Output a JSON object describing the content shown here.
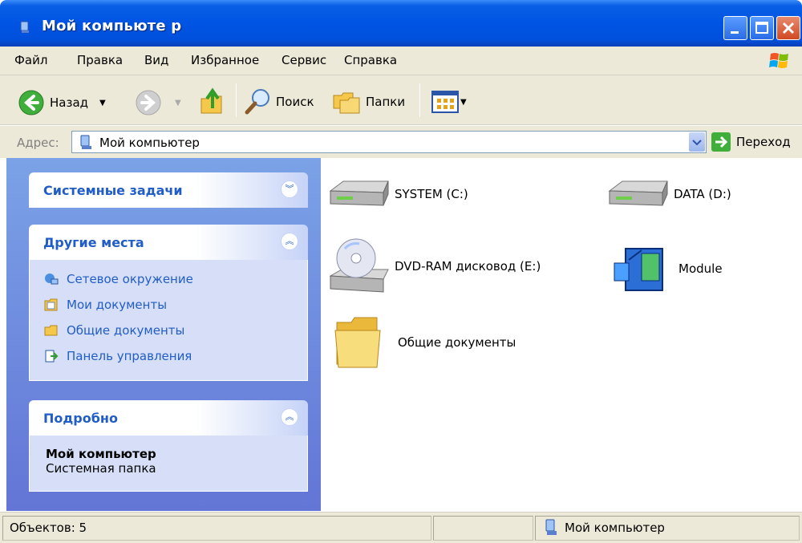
{
  "window": {
    "title": "Мой компьюте р"
  },
  "menu": [
    "Файл",
    "Правка",
    "Вид",
    "Избранное",
    "Сервис",
    "Справка"
  ],
  "toolbar": {
    "back_label": "Назад",
    "search_label": "Поиск",
    "folders_label": "Папки"
  },
  "address": {
    "label": "Адрес:",
    "value": "Мой компьютер",
    "go_label": "Переход"
  },
  "tasks": {
    "system": {
      "title": "Системные задачи"
    },
    "other": {
      "title": "Другие места",
      "links": [
        "Сетевое окружение",
        "Мои документы",
        "Общие документы",
        "Панель управления"
      ]
    },
    "details": {
      "title": "Подробно",
      "name": "Мой компьютер",
      "type": "Системная папка"
    }
  },
  "items": [
    {
      "label": "SYSTEM (C:)",
      "icon": "hard-drive-icon"
    },
    {
      "label": "DATA (D:)",
      "icon": "hard-drive-icon"
    },
    {
      "label": "DVD-RAM дисковод (E:)",
      "icon": "dvd-drive-icon"
    },
    {
      "label": "Module",
      "icon": "module-icon"
    },
    {
      "label": "Общие документы",
      "icon": "folder-icon"
    }
  ],
  "status": {
    "objects": "Объектов: 5",
    "location": "Мой компьютер"
  },
  "colors": {
    "title_blue": "#0054e3",
    "task_blue": "#215dc6",
    "pane_blue": "#7ba2e7",
    "chrome": "#ece9d8"
  }
}
